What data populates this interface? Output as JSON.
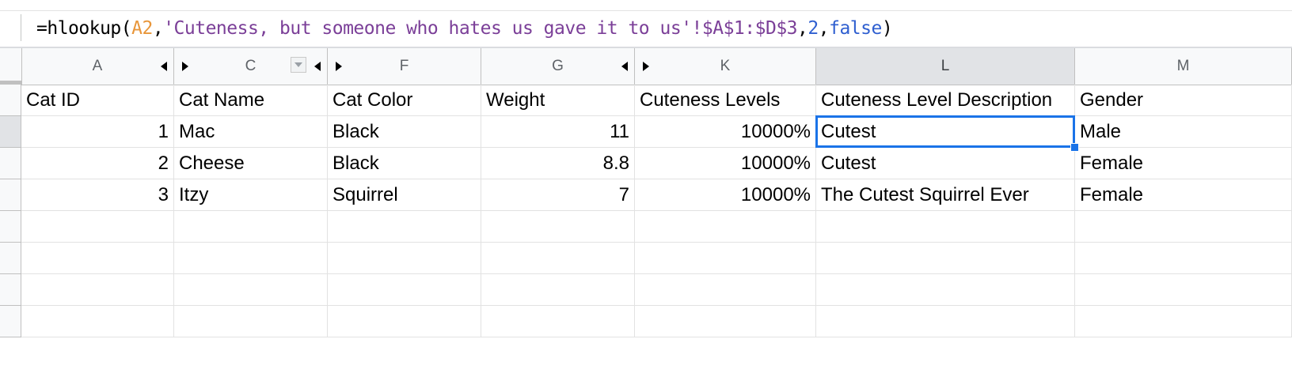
{
  "formula_bar": {
    "parts": [
      {
        "text": "=hlookup(",
        "kind": "plain"
      },
      {
        "text": "A2",
        "kind": "ref"
      },
      {
        "text": ",",
        "kind": "plain"
      },
      {
        "text": "'Cuteness, but someone who hates us gave it to us'!$A$1:$D$3",
        "kind": "str"
      },
      {
        "text": ",",
        "kind": "plain"
      },
      {
        "text": "2",
        "kind": "num"
      },
      {
        "text": ",",
        "kind": "plain"
      },
      {
        "text": "false",
        "kind": "kw"
      },
      {
        "text": ")",
        "kind": "plain"
      }
    ]
  },
  "columns": [
    {
      "letter": "A",
      "hidden_left": false,
      "hidden_right": true,
      "filter": false
    },
    {
      "letter": "C",
      "hidden_left": true,
      "hidden_right": true,
      "filter": true
    },
    {
      "letter": "F",
      "hidden_left": true,
      "hidden_right": false,
      "filter": false
    },
    {
      "letter": "G",
      "hidden_left": false,
      "hidden_right": true,
      "filter": false
    },
    {
      "letter": "K",
      "hidden_left": true,
      "hidden_right": false,
      "filter": false
    },
    {
      "letter": "L",
      "hidden_left": false,
      "hidden_right": false,
      "filter": false,
      "selected": true
    },
    {
      "letter": "M",
      "hidden_left": false,
      "hidden_right": false,
      "filter": false
    }
  ],
  "header_row": [
    "Cat ID",
    "Cat Name",
    "Cat Color",
    "Weight",
    "Cuteness Levels",
    "Cuteness Level Description",
    "Gender"
  ],
  "rows": [
    [
      "1",
      "Mac",
      "Black",
      "11",
      "10000%",
      "Cutest",
      "Male"
    ],
    [
      "2",
      "Cheese",
      "Black",
      "8.8",
      "10000%",
      "Cutest",
      "Female"
    ],
    [
      "3",
      "Itzy",
      "Squirrel",
      "7",
      "10000%",
      "The Cutest Squirrel Ever",
      "Female"
    ],
    [
      "",
      "",
      "",
      "",
      "",
      "",
      ""
    ],
    [
      "",
      "",
      "",
      "",
      "",
      "",
      ""
    ],
    [
      "",
      "",
      "",
      "",
      "",
      "",
      ""
    ],
    [
      "",
      "",
      "",
      "",
      "",
      "",
      ""
    ]
  ],
  "numeric_columns": [
    0,
    3,
    4
  ],
  "active_cell": {
    "row": 1,
    "col": 5
  },
  "colors": {
    "selection": "#1a73e8",
    "ref": "#e8963a",
    "string": "#7b3f98",
    "number": "#2f5fd0"
  }
}
